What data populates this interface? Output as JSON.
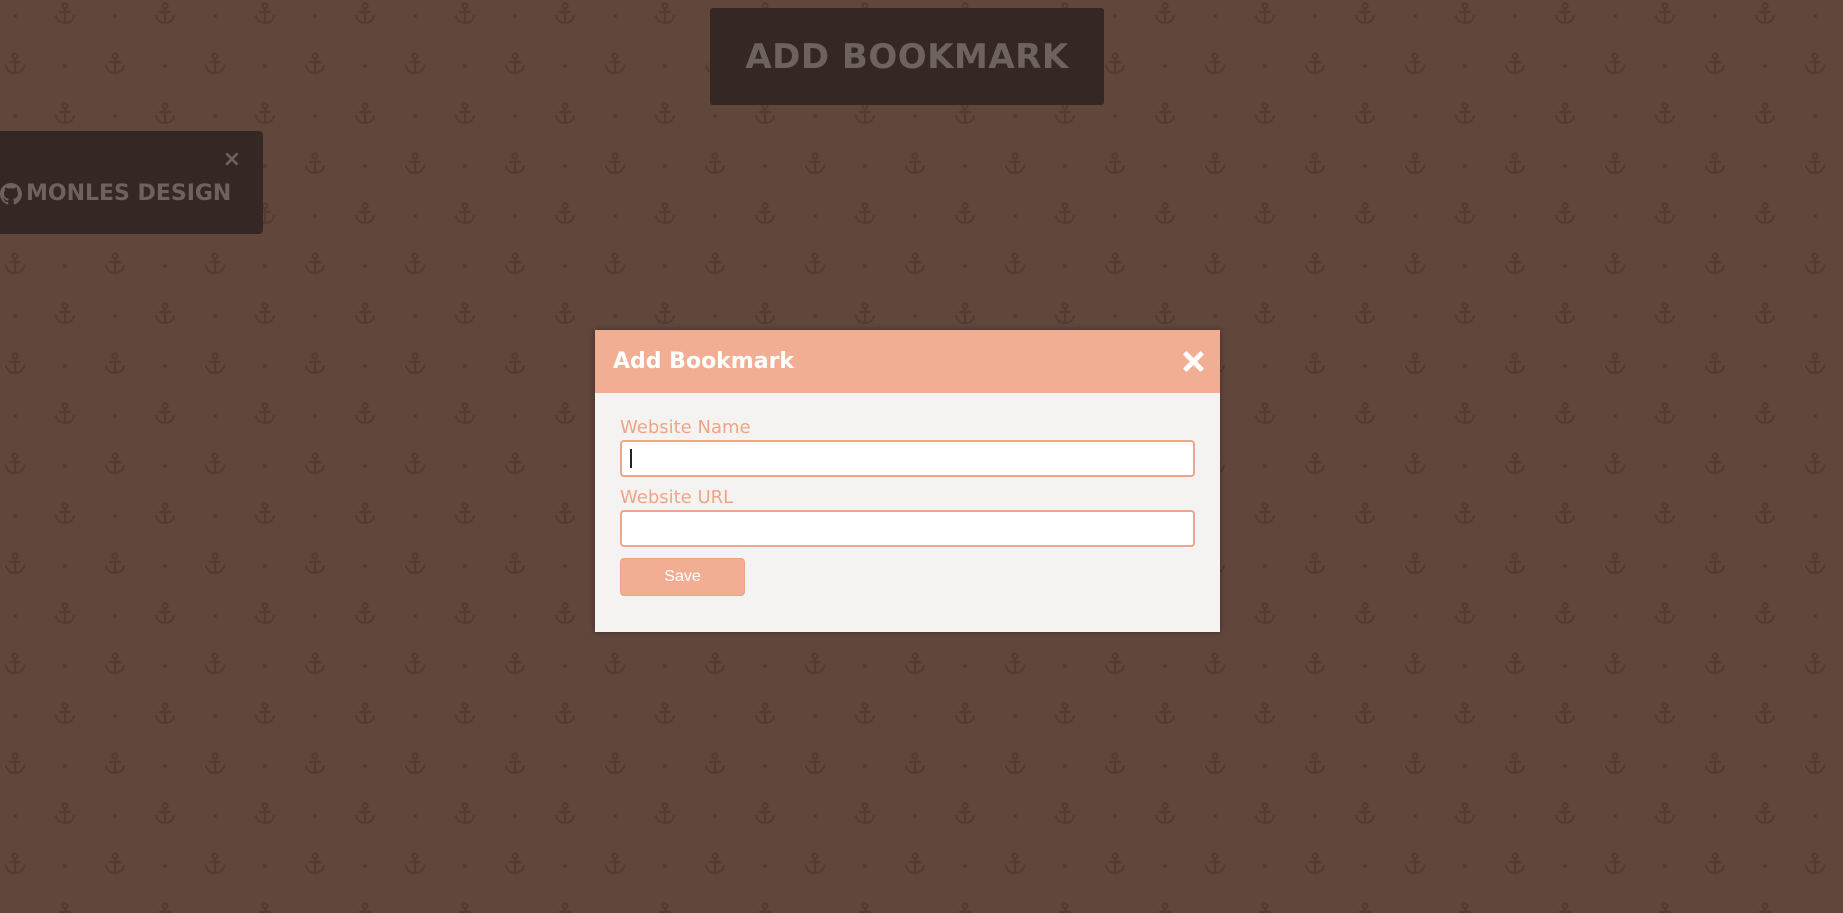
{
  "page": {
    "background_color": "#7d5a4d",
    "pattern_icon": "anchor-icon"
  },
  "banner": {
    "label": "ADD BOOKMARK"
  },
  "credit": {
    "close_glyph": "×",
    "icon": "github-icon",
    "label": "MONLES DESIGN"
  },
  "modal": {
    "title": "Add Bookmark",
    "close_icon": "close-icon",
    "accent_color": "#f2ae93",
    "fields": [
      {
        "label": "Website Name",
        "value": "",
        "placeholder": ""
      },
      {
        "label": "Website URL",
        "value": "",
        "placeholder": ""
      }
    ],
    "save_label": "Save"
  }
}
